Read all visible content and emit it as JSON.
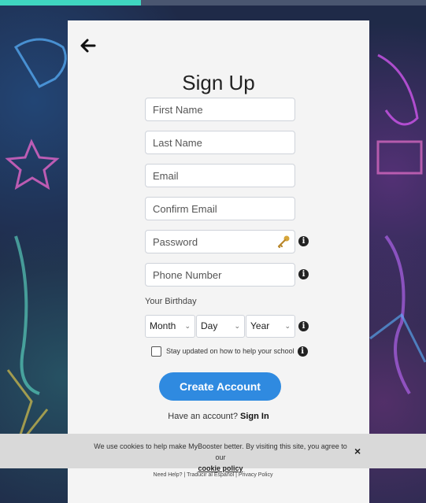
{
  "page": {
    "back_icon": "arrow-left-icon",
    "title": "Sign Up"
  },
  "form": {
    "first_name_placeholder": "First Name",
    "last_name_placeholder": "Last Name",
    "email_placeholder": "Email",
    "confirm_email_placeholder": "Confirm Email",
    "password_placeholder": "Password",
    "phone_placeholder": "Phone Number",
    "birthday_label": "Your Birthday",
    "month": "Month",
    "day": "Day",
    "year": "Year",
    "stay_updated": "Stay updated on how to help your school",
    "create_button": "Create Account",
    "have_account": "Have an account?",
    "sign_in": "Sign In",
    "info_glyph": "i"
  },
  "cookie": {
    "text": "We use cookies to help make MyBooster better. By visiting this site, you agree to our",
    "link": "cookie policy",
    "close": "×"
  },
  "footer": {
    "help": "Need Help?",
    "translate": "Traducir al Español",
    "privacy": "Privacy Policy",
    "separator": "|"
  },
  "colors": {
    "accent": "#2f8ae0",
    "progress": "#3fd6c0"
  },
  "progress": {
    "fraction": 0.33
  }
}
